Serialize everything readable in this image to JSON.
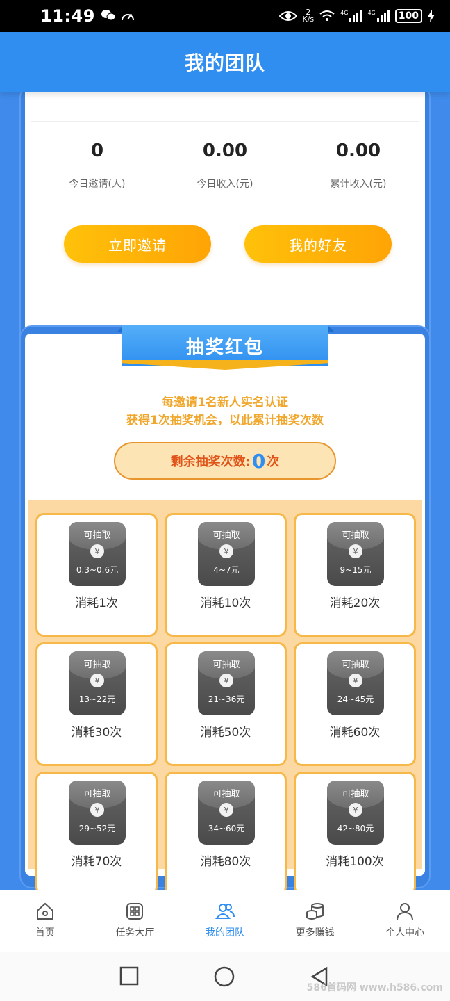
{
  "status_bar": {
    "time": "11:49",
    "net_speed_top": "2",
    "net_speed_bottom": "K/s",
    "signal1": "4G",
    "signal2": "4G",
    "battery": "100"
  },
  "header": {
    "title": "我的团队"
  },
  "stats": [
    {
      "value": "0",
      "label": "今日邀请(人)"
    },
    {
      "value": "0.00",
      "label": "今日收入(元)"
    },
    {
      "value": "0.00",
      "label": "累计收入(元)"
    }
  ],
  "actions": {
    "invite": "立即邀请",
    "friends": "我的好友"
  },
  "lottery": {
    "title": "抽奖红包",
    "tip_line1": "每邀请1名新人实名认证",
    "tip_line2": "获得1次抽奖机会，以此累计抽奖次数",
    "remain_label": "剩余抽奖次数:",
    "remain_count": "0",
    "remain_unit": "次",
    "envelope_label": "可抽取",
    "coin": "¥",
    "items": [
      {
        "range": "0.3~0.6元",
        "cost": "消耗1次"
      },
      {
        "range": "4~7元",
        "cost": "消耗10次"
      },
      {
        "range": "9~15元",
        "cost": "消耗20次"
      },
      {
        "range": "13~22元",
        "cost": "消耗30次"
      },
      {
        "range": "21~36元",
        "cost": "消耗50次"
      },
      {
        "range": "24~45元",
        "cost": "消耗60次"
      },
      {
        "range": "29~52元",
        "cost": "消耗70次"
      },
      {
        "range": "34~60元",
        "cost": "消耗80次"
      },
      {
        "range": "42~80元",
        "cost": "消耗100次"
      }
    ]
  },
  "bottom_nav": [
    {
      "label": "首页",
      "icon": "home-icon"
    },
    {
      "label": "任务大厅",
      "icon": "grid-icon"
    },
    {
      "label": "我的团队",
      "icon": "team-icon",
      "active": true
    },
    {
      "label": "更多赚钱",
      "icon": "coins-icon"
    },
    {
      "label": "个人中心",
      "icon": "user-icon"
    }
  ],
  "watermark": "586首码网 www.h586.com",
  "colors": {
    "primary": "#2f8ef0",
    "orange": "#ffa405",
    "tip": "#f0a72c"
  }
}
